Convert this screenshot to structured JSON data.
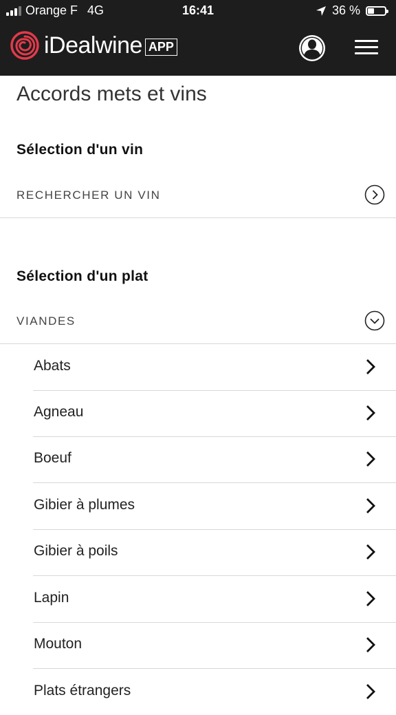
{
  "status_bar": {
    "carrier": "Orange F",
    "network": "4G",
    "time": "16:41",
    "battery": "36 %",
    "battery_level": 0.36,
    "signal_bars": 3
  },
  "header": {
    "brand": "iDealwine",
    "brand_badge": "APP",
    "account_icon": "user-icon",
    "menu_icon": "hamburger-icon",
    "colors": {
      "bar": "#1d1d1d",
      "accent": "#e23a4b"
    }
  },
  "page": {
    "title": "Accords mets et vins",
    "wine_section": {
      "title": "Sélection d'un vin",
      "search_label": "RECHERCHER UN VIN"
    },
    "dish_section": {
      "title": "Sélection d'un plat",
      "category_label": "VIANDES",
      "items": [
        "Abats",
        "Agneau",
        "Boeuf",
        "Gibier à plumes",
        "Gibier à poils",
        "Lapin",
        "Mouton",
        "Plats étrangers"
      ]
    }
  }
}
